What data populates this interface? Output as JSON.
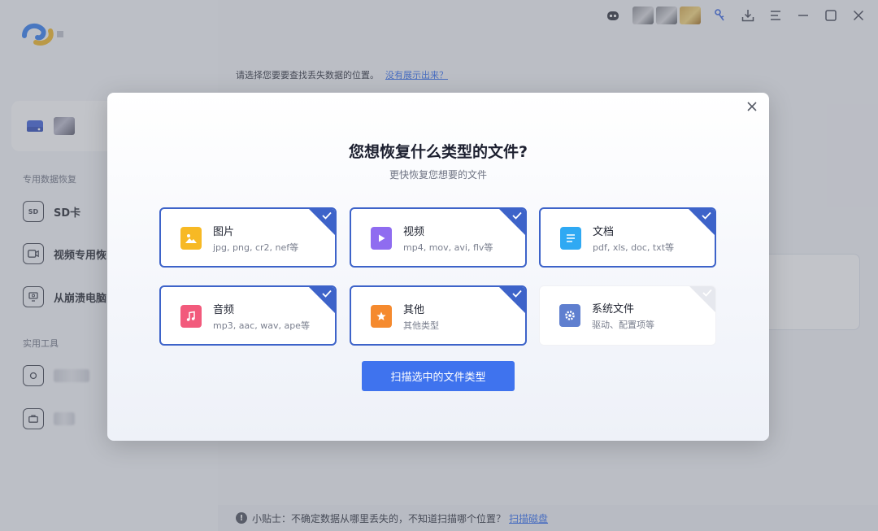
{
  "sidebar": {
    "section_dedicated": "专用数据恢复",
    "items": [
      {
        "label": "SD卡",
        "icon": "sd-card-icon"
      },
      {
        "label": "视频专用恢",
        "icon": "video-camera-icon"
      },
      {
        "label": "从崩溃电脑",
        "icon": "crashed-computer-icon"
      }
    ],
    "section_tools": "实用工具",
    "sd_icon_text": "SD"
  },
  "main": {
    "instruction": "请选择您要要查找丢失数据的位置。",
    "instruction_link": "没有展示出来？"
  },
  "tipbar": {
    "info_glyph": "!",
    "text": "小贴士：不确定数据从哪里丢失的，不知道扫描哪个位置？",
    "link": "扫描磁盘"
  },
  "dialog": {
    "title": "您想恢复什么类型的文件?",
    "subtitle": "更快恢复您想要的文件",
    "scan_button": "扫描选中的文件类型",
    "types": [
      {
        "name": "图片",
        "desc": "jpg, png, cr2, nef等",
        "checked": true,
        "color": "#f7b924",
        "icon": "image-file-icon"
      },
      {
        "name": "视频",
        "desc": "mp4, mov, avi, flv等",
        "checked": true,
        "color": "#8f6cf0",
        "icon": "video-file-icon"
      },
      {
        "name": "文档",
        "desc": "pdf, xls, doc, txt等",
        "checked": true,
        "color": "#2fa9f3",
        "icon": "document-file-icon"
      },
      {
        "name": "音频",
        "desc": "mp3, aac, wav, ape等",
        "checked": true,
        "color": "#f25a7c",
        "icon": "audio-file-icon"
      },
      {
        "name": "其他",
        "desc": "其他类型",
        "checked": true,
        "color": "#f58a2e",
        "icon": "other-file-icon"
      },
      {
        "name": "系统文件",
        "desc": "驱动、配置项等",
        "checked": false,
        "color": "#5f7fcf",
        "icon": "system-file-icon"
      }
    ]
  },
  "colors": {
    "accent": "#3f73ee",
    "card_border": "#3d63c9",
    "link": "#2f6bf0"
  }
}
